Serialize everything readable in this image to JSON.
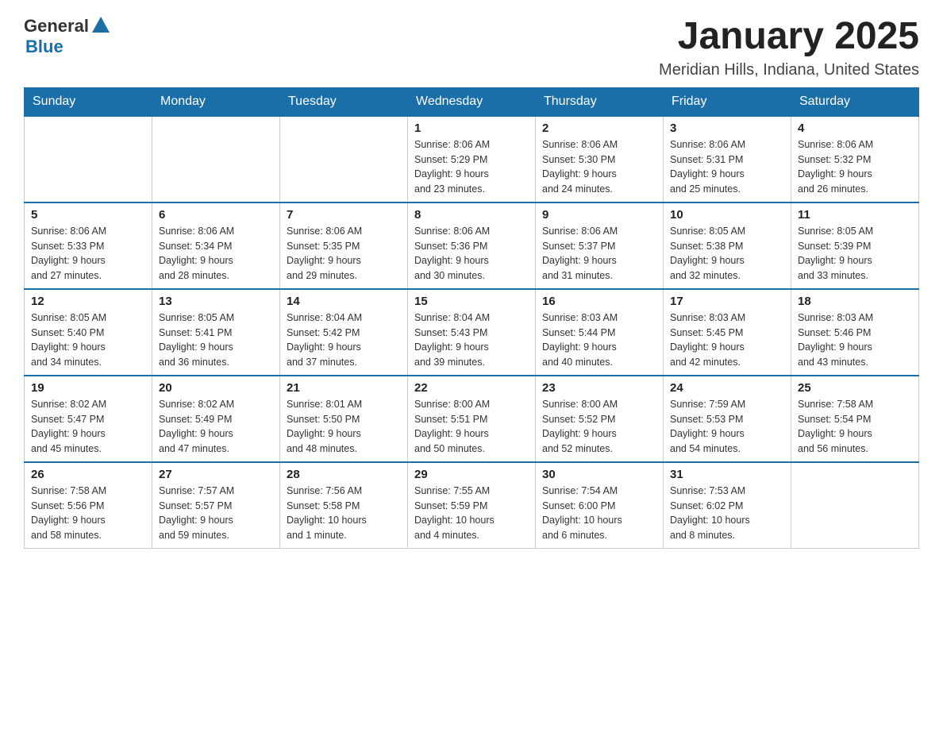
{
  "header": {
    "logo_general": "General",
    "logo_blue": "Blue",
    "title": "January 2025",
    "subtitle": "Meridian Hills, Indiana, United States"
  },
  "calendar": {
    "days_of_week": [
      "Sunday",
      "Monday",
      "Tuesday",
      "Wednesday",
      "Thursday",
      "Friday",
      "Saturday"
    ],
    "weeks": [
      [
        {
          "day": "",
          "info": ""
        },
        {
          "day": "",
          "info": ""
        },
        {
          "day": "",
          "info": ""
        },
        {
          "day": "1",
          "info": "Sunrise: 8:06 AM\nSunset: 5:29 PM\nDaylight: 9 hours\nand 23 minutes."
        },
        {
          "day": "2",
          "info": "Sunrise: 8:06 AM\nSunset: 5:30 PM\nDaylight: 9 hours\nand 24 minutes."
        },
        {
          "day": "3",
          "info": "Sunrise: 8:06 AM\nSunset: 5:31 PM\nDaylight: 9 hours\nand 25 minutes."
        },
        {
          "day": "4",
          "info": "Sunrise: 8:06 AM\nSunset: 5:32 PM\nDaylight: 9 hours\nand 26 minutes."
        }
      ],
      [
        {
          "day": "5",
          "info": "Sunrise: 8:06 AM\nSunset: 5:33 PM\nDaylight: 9 hours\nand 27 minutes."
        },
        {
          "day": "6",
          "info": "Sunrise: 8:06 AM\nSunset: 5:34 PM\nDaylight: 9 hours\nand 28 minutes."
        },
        {
          "day": "7",
          "info": "Sunrise: 8:06 AM\nSunset: 5:35 PM\nDaylight: 9 hours\nand 29 minutes."
        },
        {
          "day": "8",
          "info": "Sunrise: 8:06 AM\nSunset: 5:36 PM\nDaylight: 9 hours\nand 30 minutes."
        },
        {
          "day": "9",
          "info": "Sunrise: 8:06 AM\nSunset: 5:37 PM\nDaylight: 9 hours\nand 31 minutes."
        },
        {
          "day": "10",
          "info": "Sunrise: 8:05 AM\nSunset: 5:38 PM\nDaylight: 9 hours\nand 32 minutes."
        },
        {
          "day": "11",
          "info": "Sunrise: 8:05 AM\nSunset: 5:39 PM\nDaylight: 9 hours\nand 33 minutes."
        }
      ],
      [
        {
          "day": "12",
          "info": "Sunrise: 8:05 AM\nSunset: 5:40 PM\nDaylight: 9 hours\nand 34 minutes."
        },
        {
          "day": "13",
          "info": "Sunrise: 8:05 AM\nSunset: 5:41 PM\nDaylight: 9 hours\nand 36 minutes."
        },
        {
          "day": "14",
          "info": "Sunrise: 8:04 AM\nSunset: 5:42 PM\nDaylight: 9 hours\nand 37 minutes."
        },
        {
          "day": "15",
          "info": "Sunrise: 8:04 AM\nSunset: 5:43 PM\nDaylight: 9 hours\nand 39 minutes."
        },
        {
          "day": "16",
          "info": "Sunrise: 8:03 AM\nSunset: 5:44 PM\nDaylight: 9 hours\nand 40 minutes."
        },
        {
          "day": "17",
          "info": "Sunrise: 8:03 AM\nSunset: 5:45 PM\nDaylight: 9 hours\nand 42 minutes."
        },
        {
          "day": "18",
          "info": "Sunrise: 8:03 AM\nSunset: 5:46 PM\nDaylight: 9 hours\nand 43 minutes."
        }
      ],
      [
        {
          "day": "19",
          "info": "Sunrise: 8:02 AM\nSunset: 5:47 PM\nDaylight: 9 hours\nand 45 minutes."
        },
        {
          "day": "20",
          "info": "Sunrise: 8:02 AM\nSunset: 5:49 PM\nDaylight: 9 hours\nand 47 minutes."
        },
        {
          "day": "21",
          "info": "Sunrise: 8:01 AM\nSunset: 5:50 PM\nDaylight: 9 hours\nand 48 minutes."
        },
        {
          "day": "22",
          "info": "Sunrise: 8:00 AM\nSunset: 5:51 PM\nDaylight: 9 hours\nand 50 minutes."
        },
        {
          "day": "23",
          "info": "Sunrise: 8:00 AM\nSunset: 5:52 PM\nDaylight: 9 hours\nand 52 minutes."
        },
        {
          "day": "24",
          "info": "Sunrise: 7:59 AM\nSunset: 5:53 PM\nDaylight: 9 hours\nand 54 minutes."
        },
        {
          "day": "25",
          "info": "Sunrise: 7:58 AM\nSunset: 5:54 PM\nDaylight: 9 hours\nand 56 minutes."
        }
      ],
      [
        {
          "day": "26",
          "info": "Sunrise: 7:58 AM\nSunset: 5:56 PM\nDaylight: 9 hours\nand 58 minutes."
        },
        {
          "day": "27",
          "info": "Sunrise: 7:57 AM\nSunset: 5:57 PM\nDaylight: 9 hours\nand 59 minutes."
        },
        {
          "day": "28",
          "info": "Sunrise: 7:56 AM\nSunset: 5:58 PM\nDaylight: 10 hours\nand 1 minute."
        },
        {
          "day": "29",
          "info": "Sunrise: 7:55 AM\nSunset: 5:59 PM\nDaylight: 10 hours\nand 4 minutes."
        },
        {
          "day": "30",
          "info": "Sunrise: 7:54 AM\nSunset: 6:00 PM\nDaylight: 10 hours\nand 6 minutes."
        },
        {
          "day": "31",
          "info": "Sunrise: 7:53 AM\nSunset: 6:02 PM\nDaylight: 10 hours\nand 8 minutes."
        },
        {
          "day": "",
          "info": ""
        }
      ]
    ]
  }
}
